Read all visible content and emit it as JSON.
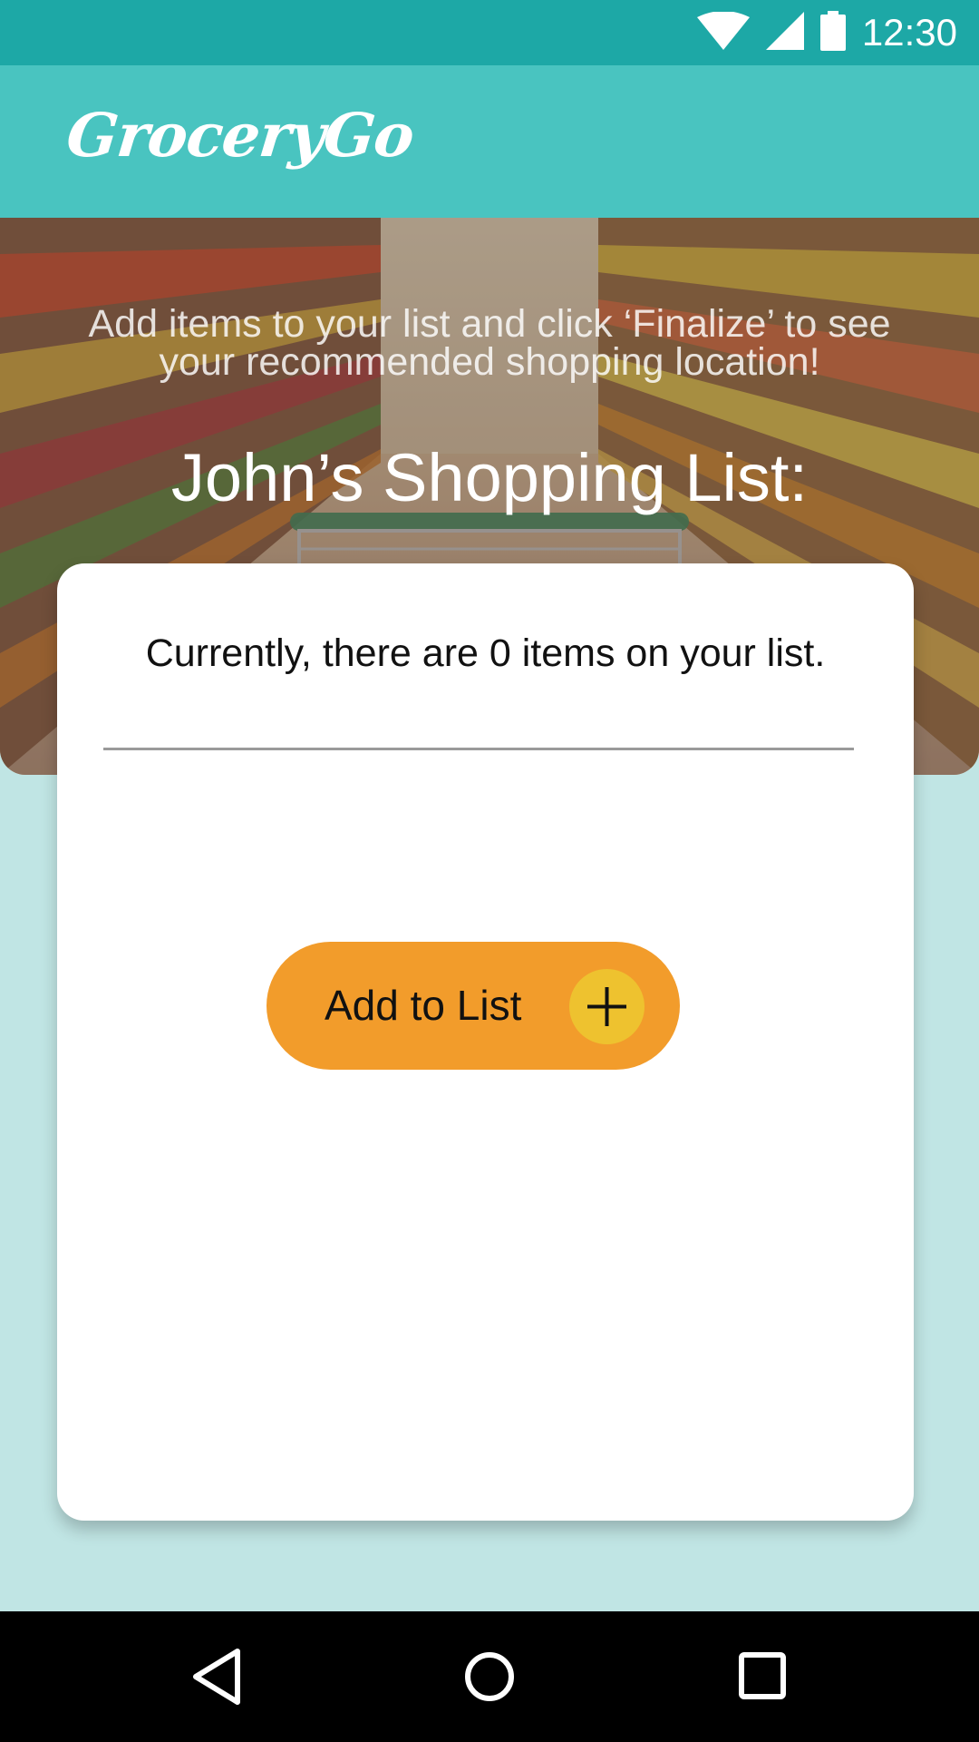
{
  "status_bar": {
    "time": "12:30",
    "icons": [
      "wifi-icon",
      "cell-signal-icon",
      "battery-icon"
    ],
    "color": "#1da8a6"
  },
  "app_bar": {
    "title": "GroceryGo",
    "color": "#49c4c0"
  },
  "hero": {
    "hint": "Add items to your list and click ‘Finalize’ to see your recommended shopping location!",
    "title": "John’s Shopping List:"
  },
  "list_card": {
    "status_text": "Currently, there are 0 items on your list.",
    "add_button_label": "Add to List",
    "add_button_color": "#f29c2b",
    "plus_color": "#eec22f"
  },
  "nav_bar": {
    "buttons": [
      "back-icon",
      "home-icon",
      "recents-icon"
    ]
  },
  "colors": {
    "page_background": "#c0e5e4"
  }
}
